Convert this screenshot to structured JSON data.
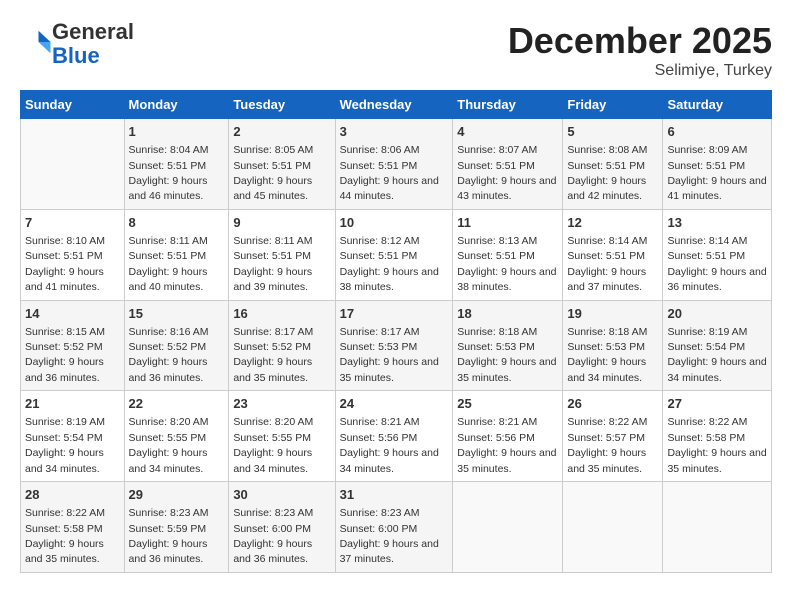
{
  "header": {
    "logo_line1": "General",
    "logo_line2": "Blue",
    "month": "December 2025",
    "location": "Selimiye, Turkey"
  },
  "weekdays": [
    "Sunday",
    "Monday",
    "Tuesday",
    "Wednesday",
    "Thursday",
    "Friday",
    "Saturday"
  ],
  "weeks": [
    [
      {
        "day": "",
        "sunrise": "",
        "sunset": "",
        "daylight": ""
      },
      {
        "day": "1",
        "sunrise": "Sunrise: 8:04 AM",
        "sunset": "Sunset: 5:51 PM",
        "daylight": "Daylight: 9 hours and 46 minutes."
      },
      {
        "day": "2",
        "sunrise": "Sunrise: 8:05 AM",
        "sunset": "Sunset: 5:51 PM",
        "daylight": "Daylight: 9 hours and 45 minutes."
      },
      {
        "day": "3",
        "sunrise": "Sunrise: 8:06 AM",
        "sunset": "Sunset: 5:51 PM",
        "daylight": "Daylight: 9 hours and 44 minutes."
      },
      {
        "day": "4",
        "sunrise": "Sunrise: 8:07 AM",
        "sunset": "Sunset: 5:51 PM",
        "daylight": "Daylight: 9 hours and 43 minutes."
      },
      {
        "day": "5",
        "sunrise": "Sunrise: 8:08 AM",
        "sunset": "Sunset: 5:51 PM",
        "daylight": "Daylight: 9 hours and 42 minutes."
      },
      {
        "day": "6",
        "sunrise": "Sunrise: 8:09 AM",
        "sunset": "Sunset: 5:51 PM",
        "daylight": "Daylight: 9 hours and 41 minutes."
      }
    ],
    [
      {
        "day": "7",
        "sunrise": "Sunrise: 8:10 AM",
        "sunset": "Sunset: 5:51 PM",
        "daylight": "Daylight: 9 hours and 41 minutes."
      },
      {
        "day": "8",
        "sunrise": "Sunrise: 8:11 AM",
        "sunset": "Sunset: 5:51 PM",
        "daylight": "Daylight: 9 hours and 40 minutes."
      },
      {
        "day": "9",
        "sunrise": "Sunrise: 8:11 AM",
        "sunset": "Sunset: 5:51 PM",
        "daylight": "Daylight: 9 hours and 39 minutes."
      },
      {
        "day": "10",
        "sunrise": "Sunrise: 8:12 AM",
        "sunset": "Sunset: 5:51 PM",
        "daylight": "Daylight: 9 hours and 38 minutes."
      },
      {
        "day": "11",
        "sunrise": "Sunrise: 8:13 AM",
        "sunset": "Sunset: 5:51 PM",
        "daylight": "Daylight: 9 hours and 38 minutes."
      },
      {
        "day": "12",
        "sunrise": "Sunrise: 8:14 AM",
        "sunset": "Sunset: 5:51 PM",
        "daylight": "Daylight: 9 hours and 37 minutes."
      },
      {
        "day": "13",
        "sunrise": "Sunrise: 8:14 AM",
        "sunset": "Sunset: 5:51 PM",
        "daylight": "Daylight: 9 hours and 36 minutes."
      }
    ],
    [
      {
        "day": "14",
        "sunrise": "Sunrise: 8:15 AM",
        "sunset": "Sunset: 5:52 PM",
        "daylight": "Daylight: 9 hours and 36 minutes."
      },
      {
        "day": "15",
        "sunrise": "Sunrise: 8:16 AM",
        "sunset": "Sunset: 5:52 PM",
        "daylight": "Daylight: 9 hours and 36 minutes."
      },
      {
        "day": "16",
        "sunrise": "Sunrise: 8:17 AM",
        "sunset": "Sunset: 5:52 PM",
        "daylight": "Daylight: 9 hours and 35 minutes."
      },
      {
        "day": "17",
        "sunrise": "Sunrise: 8:17 AM",
        "sunset": "Sunset: 5:53 PM",
        "daylight": "Daylight: 9 hours and 35 minutes."
      },
      {
        "day": "18",
        "sunrise": "Sunrise: 8:18 AM",
        "sunset": "Sunset: 5:53 PM",
        "daylight": "Daylight: 9 hours and 35 minutes."
      },
      {
        "day": "19",
        "sunrise": "Sunrise: 8:18 AM",
        "sunset": "Sunset: 5:53 PM",
        "daylight": "Daylight: 9 hours and 34 minutes."
      },
      {
        "day": "20",
        "sunrise": "Sunrise: 8:19 AM",
        "sunset": "Sunset: 5:54 PM",
        "daylight": "Daylight: 9 hours and 34 minutes."
      }
    ],
    [
      {
        "day": "21",
        "sunrise": "Sunrise: 8:19 AM",
        "sunset": "Sunset: 5:54 PM",
        "daylight": "Daylight: 9 hours and 34 minutes."
      },
      {
        "day": "22",
        "sunrise": "Sunrise: 8:20 AM",
        "sunset": "Sunset: 5:55 PM",
        "daylight": "Daylight: 9 hours and 34 minutes."
      },
      {
        "day": "23",
        "sunrise": "Sunrise: 8:20 AM",
        "sunset": "Sunset: 5:55 PM",
        "daylight": "Daylight: 9 hours and 34 minutes."
      },
      {
        "day": "24",
        "sunrise": "Sunrise: 8:21 AM",
        "sunset": "Sunset: 5:56 PM",
        "daylight": "Daylight: 9 hours and 34 minutes."
      },
      {
        "day": "25",
        "sunrise": "Sunrise: 8:21 AM",
        "sunset": "Sunset: 5:56 PM",
        "daylight": "Daylight: 9 hours and 35 minutes."
      },
      {
        "day": "26",
        "sunrise": "Sunrise: 8:22 AM",
        "sunset": "Sunset: 5:57 PM",
        "daylight": "Daylight: 9 hours and 35 minutes."
      },
      {
        "day": "27",
        "sunrise": "Sunrise: 8:22 AM",
        "sunset": "Sunset: 5:58 PM",
        "daylight": "Daylight: 9 hours and 35 minutes."
      }
    ],
    [
      {
        "day": "28",
        "sunrise": "Sunrise: 8:22 AM",
        "sunset": "Sunset: 5:58 PM",
        "daylight": "Daylight: 9 hours and 35 minutes."
      },
      {
        "day": "29",
        "sunrise": "Sunrise: 8:23 AM",
        "sunset": "Sunset: 5:59 PM",
        "daylight": "Daylight: 9 hours and 36 minutes."
      },
      {
        "day": "30",
        "sunrise": "Sunrise: 8:23 AM",
        "sunset": "Sunset: 6:00 PM",
        "daylight": "Daylight: 9 hours and 36 minutes."
      },
      {
        "day": "31",
        "sunrise": "Sunrise: 8:23 AM",
        "sunset": "Sunset: 6:00 PM",
        "daylight": "Daylight: 9 hours and 37 minutes."
      },
      {
        "day": "",
        "sunrise": "",
        "sunset": "",
        "daylight": ""
      },
      {
        "day": "",
        "sunrise": "",
        "sunset": "",
        "daylight": ""
      },
      {
        "day": "",
        "sunrise": "",
        "sunset": "",
        "daylight": ""
      }
    ]
  ]
}
